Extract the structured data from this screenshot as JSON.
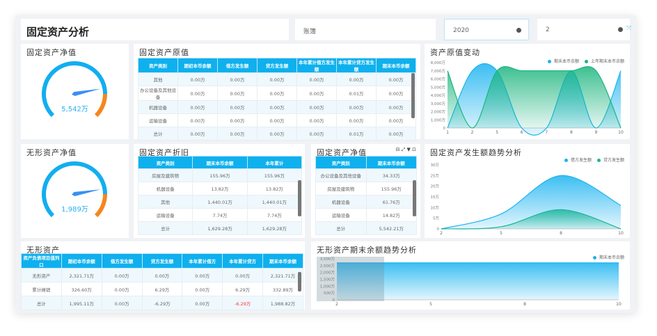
{
  "header": {
    "title": "固定资产分析"
  },
  "filters": {
    "ledger": "账簿",
    "year": "2020",
    "period": "2"
  },
  "fixed_net_gauge": {
    "title": "固定资产净值",
    "value": 5542,
    "label": "5,542万",
    "max": 7000
  },
  "intangible_net_gauge": {
    "title": "无形资产净值",
    "value": 1989,
    "label": "1,989万",
    "max": 2500
  },
  "original_value_table": {
    "title": "固定资产原值",
    "headers": [
      "资产类别",
      "期初本币余额",
      "借方发生额",
      "贷方发生额",
      "本年累计借方发生额",
      "本年累计贷方发生额",
      "期末本币余额"
    ],
    "rows": [
      [
        "其他",
        "0.00万",
        "0.00万",
        "0.00万",
        "0.00万",
        "0.00万",
        "0.00万"
      ],
      [
        "办公设备及其他设备",
        "0.00万",
        "0.00万",
        "0.00万",
        "0.00万",
        "0.01万",
        "0.00万"
      ],
      [
        "机器设备",
        "0.00万",
        "0.00万",
        "0.00万",
        "0.00万",
        "0.00万",
        "0.00万"
      ],
      [
        "运输设备",
        "0.00万",
        "0.00万",
        "0.00万",
        "0.00万",
        "0.00万",
        "0.00万"
      ],
      [
        "总计",
        "0.00万",
        "0.00万",
        "0.00万",
        "0.00万",
        "0.01万",
        "0.00万"
      ]
    ]
  },
  "depreciation_table": {
    "title": "固定资产折旧",
    "headers": [
      "资产类别",
      "期末本币余额",
      "本年累计"
    ],
    "rows": [
      [
        "房屋及建筑物",
        "155.96万",
        "155.96万"
      ],
      [
        "机器设备",
        "13.82万",
        "13.82万"
      ],
      [
        "其他",
        "1,440.01万",
        "1,440.01万"
      ],
      [
        "运输设备",
        "7.74万",
        "7.74万"
      ],
      [
        "总计",
        "1,629.28万",
        "1,629.28万"
      ]
    ]
  },
  "net_value_table": {
    "title": "固定资产净值",
    "headers": [
      "资产类别",
      "期末本币余额"
    ],
    "rows": [
      [
        "办公设备及其他设备",
        "34.33万"
      ],
      [
        "房屋及建筑物",
        "155.96万"
      ],
      [
        "机器设备",
        "61.76万"
      ],
      [
        "运输设备",
        "14.82万"
      ],
      [
        "总计",
        "5,542.21万"
      ]
    ]
  },
  "intangible_table": {
    "title": "无形资产",
    "headers": [
      "资产负债项目值列口",
      "期初本币余额",
      "借方发生额",
      "贷方发生额",
      "本年累计借方",
      "本年累计贷方",
      "期末本币余额"
    ],
    "rows": [
      [
        "无形资产",
        "2,321.71万",
        "0.00万",
        "0.00万",
        "0.00万",
        "0.00万",
        "2,321.71万"
      ],
      [
        "累计摊销",
        "326.60万",
        "0.00万",
        "6.29万",
        "0.00万",
        "6.29万",
        "332.89万"
      ],
      [
        "总计",
        "1,995.11万",
        "0.00万",
        "-6.29万",
        "0.00万",
        "-6.29万",
        "1,988.82万"
      ]
    ]
  },
  "chart_data": [
    {
      "id": "c1",
      "type": "area",
      "title": "资产原值变动",
      "x": [
        "1",
        "2",
        "5",
        "6",
        "7",
        "8",
        "9",
        "10"
      ],
      "ylim": [
        0,
        8000
      ],
      "yticks": [
        0,
        1000,
        2000,
        3000,
        4000,
        5000,
        6000,
        7000,
        8000
      ],
      "ytick_labels": [
        "0",
        "1,000万",
        "2,000万",
        "3,000万",
        "4,000万",
        "5,000万",
        "6,000万",
        "7,000万",
        "8,000万"
      ],
      "legend": "top-right",
      "series": [
        {
          "name": "期末本币余额",
          "color": "#1ab3f0",
          "values": [
            0,
            7000,
            7000,
            0,
            0,
            7000,
            0,
            7000
          ]
        },
        {
          "name": "上年期末本币余额",
          "color": "#1cb57f",
          "values": [
            7000,
            0,
            7000,
            7000,
            7000,
            7000,
            7000,
            0
          ]
        }
      ]
    },
    {
      "id": "c2",
      "type": "area",
      "title": "固定资产发生额趋势分析",
      "x": [
        "2",
        "5",
        "8",
        "10"
      ],
      "ylim": [
        0,
        30
      ],
      "yticks": [
        0,
        5,
        10,
        15,
        20,
        25,
        30
      ],
      "ytick_labels": [
        "0",
        "5万",
        "10万",
        "15万",
        "20万",
        "25万",
        "30万"
      ],
      "legend": "top-right",
      "series": [
        {
          "name": "借方发生额",
          "color": "#1ab3f0",
          "values": [
            0,
            7,
            25,
            11
          ]
        },
        {
          "name": "贷方发生额",
          "color": "#1cb59a",
          "values": [
            0,
            1,
            9,
            0
          ]
        }
      ]
    },
    {
      "id": "c3",
      "type": "area",
      "title": "无形资产期末余额趋势分析",
      "x": [
        "2",
        "5",
        "8",
        "10"
      ],
      "ylim": [
        0,
        3000
      ],
      "yticks": [
        0,
        500,
        1000,
        1500,
        2000,
        2500,
        3000
      ],
      "ytick_labels": [
        "0",
        "500万",
        "1,000万",
        "1,500万",
        "2,000万",
        "2,500万",
        "3,000万"
      ],
      "legend": "top-right",
      "series": [
        {
          "name": "期末本币余额",
          "color": "#1ab3f0",
          "values": [
            2700,
            2700,
            2700,
            2700
          ]
        }
      ]
    }
  ]
}
